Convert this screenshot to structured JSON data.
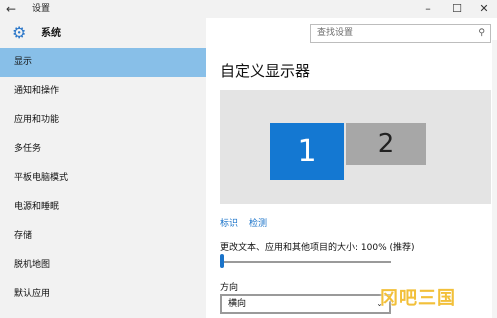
{
  "window": {
    "back_glyph": "←",
    "title": "设置",
    "min_glyph": "–",
    "max_glyph": "☐",
    "close_glyph": "✕"
  },
  "sidebar": {
    "header_label": "系统",
    "header_icon": "gear-icon",
    "items": [
      {
        "label": "显示",
        "selected": true
      },
      {
        "label": "通知和操作"
      },
      {
        "label": "应用和功能"
      },
      {
        "label": "多任务"
      },
      {
        "label": "平板电脑模式"
      },
      {
        "label": "电源和睡眠"
      },
      {
        "label": "存储"
      },
      {
        "label": "脱机地图"
      },
      {
        "label": "默认应用"
      }
    ]
  },
  "search": {
    "placeholder": "查找设置",
    "icon": "search-icon"
  },
  "main": {
    "title": "自定义显示器",
    "monitors": [
      "1",
      "2"
    ],
    "links": {
      "identify": "标识",
      "detect": "检测"
    },
    "scale_label": "更改文本、应用和其他项目的大小: 100% (推荐)",
    "scale_value_percent": 0,
    "orientation_label": "方向",
    "orientation_value": "横向"
  },
  "watermark": "冈吧三国",
  "colors": {
    "accent": "#1478d2",
    "selected_nav": "#88bfe8",
    "link": "#1a73c9",
    "sidebar_bg": "#f2f2f2"
  }
}
